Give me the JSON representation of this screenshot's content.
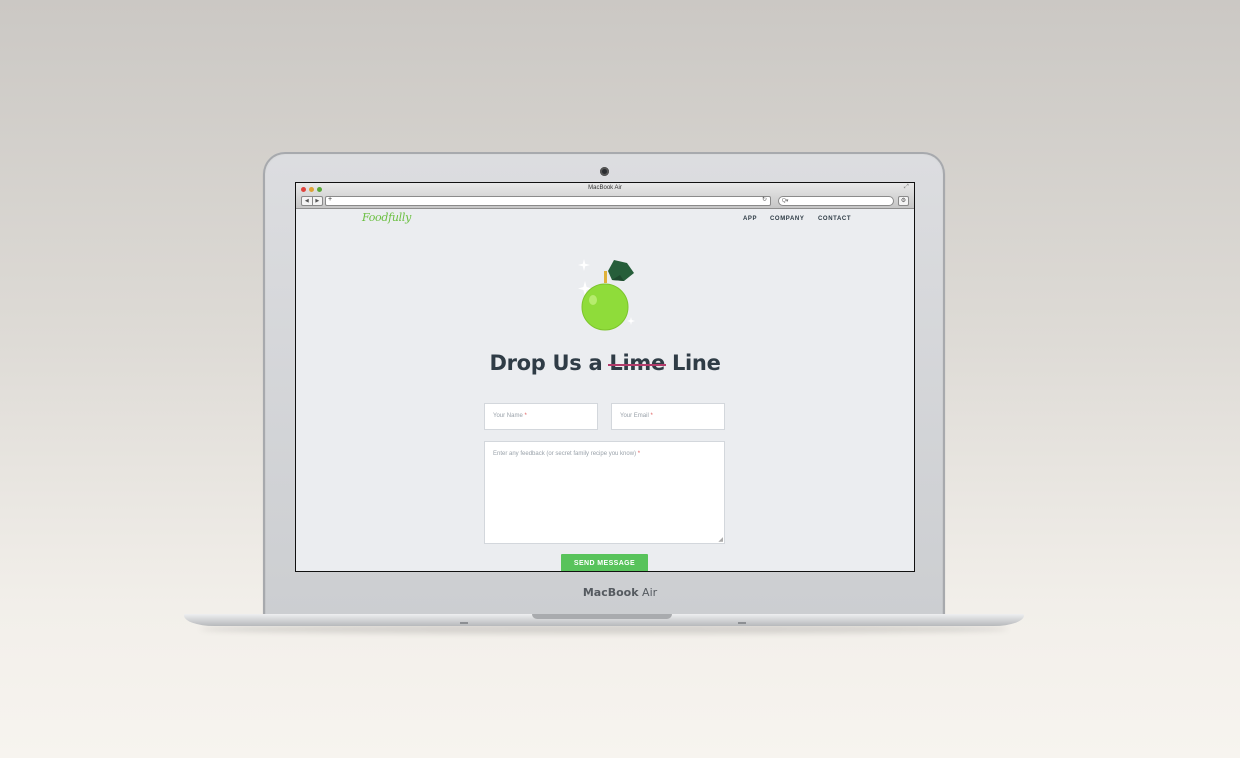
{
  "device": {
    "brand_bold": "MacBook",
    "brand_light": "Air"
  },
  "browser": {
    "window_title": "MacBook Air",
    "url": "",
    "search_placeholder": "Q▾",
    "back_label": "◀",
    "forward_label": "▶",
    "new_tab_label": "+",
    "reload_label": "↻",
    "settings_label": "⚙"
  },
  "site": {
    "logo_text": "Foodfully",
    "nav": [
      "APP",
      "COMPANY",
      "CONTACT"
    ]
  },
  "hero": {
    "heading_before": "Drop Us a",
    "heading_struck": "Lime",
    "heading_after": "Line"
  },
  "form": {
    "name_placeholder": "Your Name",
    "email_placeholder": "Your Email",
    "message_placeholder": "Enter any feedback (or secret family recipe you know)",
    "required_marker": "*",
    "submit_label": "SEND MESSAGE"
  },
  "colors": {
    "brand_green": "#6cc043",
    "button_green": "#58c35b",
    "lime": "#8fdc3a",
    "leaf": "#265e3a",
    "strike": "#b23b6a",
    "heading": "#2f3c46",
    "page_bg": "#ebedf0"
  }
}
